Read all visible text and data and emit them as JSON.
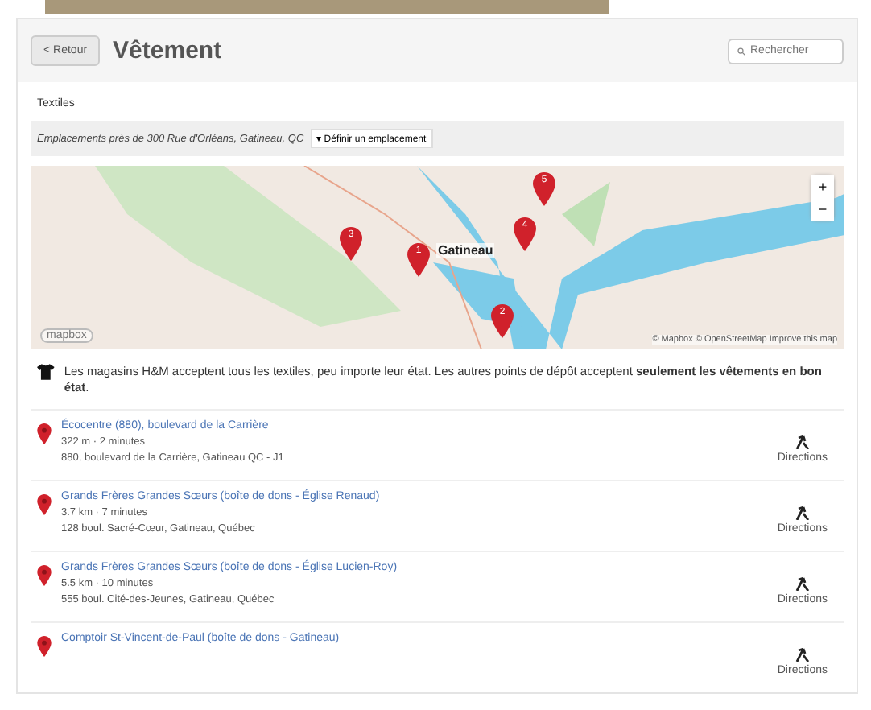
{
  "header": {
    "back": "< Retour",
    "title": "Vêtement",
    "search_placeholder": "Rechercher"
  },
  "category": "Textiles",
  "location": {
    "text": "Emplacements près de 300 Rue d'Orléans, Gatineau, QC",
    "change": "▾ Définir un emplacement"
  },
  "map": {
    "city": "Gatineau",
    "logo": "mapbox",
    "attribution": "© Mapbox © OpenStreetMap Improve this map",
    "zoom_in": "+",
    "zoom_out": "−",
    "markers": [
      "5",
      "3",
      "1",
      "4",
      "2"
    ]
  },
  "note": "Les magasins H&M acceptent tous les textiles, peu importe leur état. Les autres points de dépôt acceptent **seulement les vêtements en bon état**.",
  "places": [
    {
      "name": "Écocentre (880), boulevard de la Carrière",
      "distance": "322 m · 2 minutes",
      "address": "880, boulevard de la Carrière, Gatineau QC - J1",
      "action": "Directions"
    },
    {
      "name": "Grands Frères Grandes Sœurs (boîte de dons - Église Renaud)",
      "distance": "3.7 km · 7 minutes",
      "address": "128 boul. Sacré-Cœur, Gatineau, Québec",
      "action": "Directions"
    },
    {
      "name": "Grands Frères Grandes Sœurs (boîte de dons - Église Lucien-Roy)",
      "distance": "5.5 km · 10 minutes",
      "address": "555 boul. Cité-des-Jeunes, Gatineau, Québec",
      "action": "Directions"
    },
    {
      "name": "Comptoir St-Vincent-de-Paul (boîte de dons - Gatineau)",
      "action": "Directions"
    }
  ]
}
